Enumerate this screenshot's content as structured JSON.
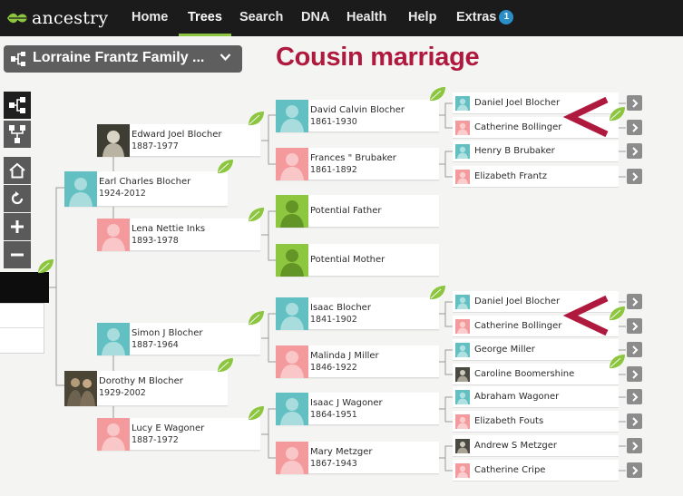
{
  "nav": {
    "logo": "ancestry",
    "items": [
      {
        "id": "home",
        "label": "Home"
      },
      {
        "id": "trees",
        "label": "Trees"
      },
      {
        "id": "search",
        "label": "Search"
      },
      {
        "id": "dna",
        "label": "DNA"
      },
      {
        "id": "health",
        "label": "Health"
      },
      {
        "id": "help",
        "label": "Help"
      },
      {
        "id": "extras",
        "label": "Extras"
      }
    ],
    "extras_badge": "1",
    "active": "Trees"
  },
  "tree_selector": {
    "label": "Lorraine Frantz Family ...",
    "icon": "tree-view-icon",
    "chevron": "chevron-down-icon"
  },
  "annotation": {
    "title": "Cousin marriage",
    "marker": "<",
    "color": "#b0193e"
  },
  "toolbar": [
    "pedigree-view-icon",
    "family-view-icon",
    "home-icon",
    "refresh-icon",
    "zoom-in-icon",
    "zoom-out-icon"
  ],
  "colors": {
    "male": "#62c0c2",
    "female": "#f49a9c",
    "potential": "#8dc63f",
    "hint_leaf": "#8cc63f",
    "nav_bg": "#1b1b1b",
    "accent": "#8cc63f"
  },
  "tree": {
    "edward": {
      "name": "Edward Joel Blocher",
      "dates": "1887-1977"
    },
    "earl": {
      "name": "Earl Charles Blocher",
      "dates": "1924-2012"
    },
    "lena": {
      "name": "Lena Nettie Inks",
      "dates": "1893-1978"
    },
    "david": {
      "name": "David Calvin Blocher",
      "dates": "1861-1930"
    },
    "frances": {
      "name": "Frances \" Brubaker",
      "dates": "1861-1892"
    },
    "potential_father": {
      "name": "Potential Father"
    },
    "potential_mother": {
      "name": "Potential Mother"
    },
    "simon": {
      "name": "Simon J Blocher",
      "dates": "1887-1964"
    },
    "dorothy": {
      "name": "Dorothy M Blocher",
      "dates": "1929-2002"
    },
    "lucy": {
      "name": "Lucy E Wagoner",
      "dates": "1887-1972"
    },
    "isaac_b": {
      "name": "Isaac Blocher",
      "dates": "1841-1902"
    },
    "malinda": {
      "name": "Malinda J Miller",
      "dates": "1846-1922"
    },
    "isaac_w": {
      "name": "Isaac J Wagoner",
      "dates": "1864-1951"
    },
    "mary": {
      "name": "Mary Metzger",
      "dates": "1867-1943"
    },
    "gen4": [
      "Daniel Joel Blocher",
      "Catherine Bollinger",
      "Henry B Brubaker",
      "Elizabeth Frantz",
      "Daniel Joel Blocher",
      "Catherine Bollinger",
      "George Miller",
      "Caroline Boomershine",
      "Abraham Wagoner",
      "Elizabeth Fouts",
      "Andrew S Metzger",
      "Catherine Cripe"
    ]
  }
}
